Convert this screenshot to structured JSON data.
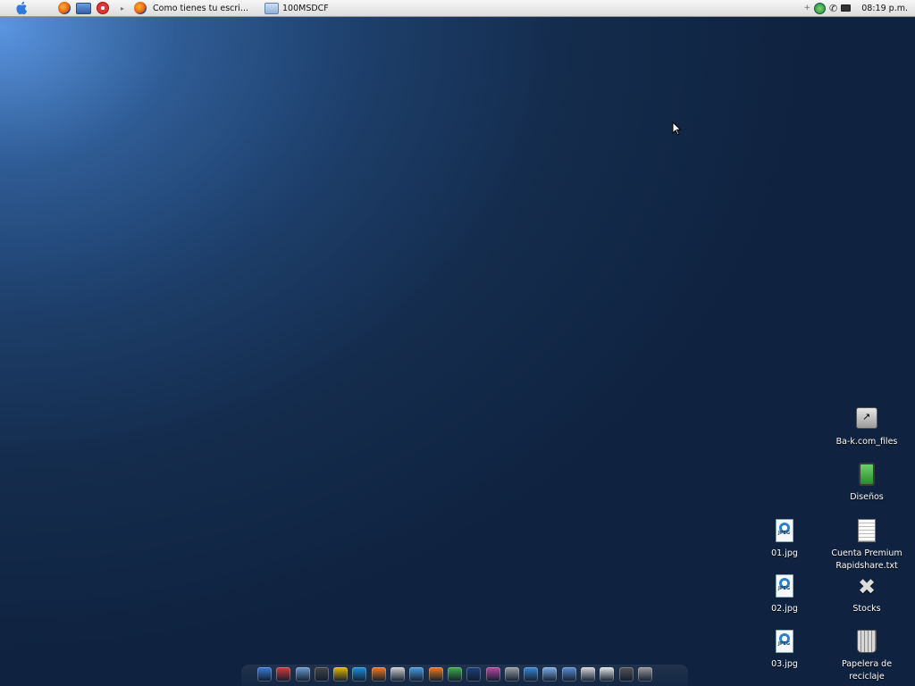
{
  "menubar": {
    "apple_icon": "apple-icon",
    "quicklaunch": [
      "firefox-icon",
      "window-icon",
      "stop-icon"
    ],
    "tasks": [
      {
        "icon": "firefox-icon",
        "label": "Como tienes tu escri..."
      },
      {
        "icon": "folder-icon",
        "label": "100MSDCF"
      }
    ],
    "tray": [
      "plus-icon",
      "globe-icon",
      "phone-icon",
      "battery-icon"
    ],
    "clock": "08:19 p.m."
  },
  "desktop": {
    "icons": [
      {
        "name": "Ba-k.com_files",
        "type": "drive-shortcut-icon"
      },
      {
        "name": "Diseños",
        "type": "pda-icon"
      },
      {
        "name": "01.jpg",
        "type": "jpeg-file-icon"
      },
      {
        "name": "Cuenta Premium Rapidshare.txt",
        "type": "text-file-icon"
      },
      {
        "name": "02.jpg",
        "type": "jpeg-file-icon"
      },
      {
        "name": "Stocks",
        "type": "tools-icon"
      },
      {
        "name": "03.jpg",
        "type": "jpeg-file-icon"
      },
      {
        "name": "Papelera de reciclaje",
        "type": "trash-icon"
      }
    ]
  },
  "dock": {
    "items": [
      {
        "icon": "finder-icon",
        "color": "#3b7bd6"
      },
      {
        "icon": "mail-icon",
        "color": "#d23b3b"
      },
      {
        "icon": "photos-icon",
        "color": "#6f9bd0"
      },
      {
        "icon": "camera-icon",
        "color": "#444444"
      },
      {
        "icon": "keys-icon",
        "color": "#e6b800"
      },
      {
        "icon": "messenger-icon",
        "color": "#1d8fd8"
      },
      {
        "icon": "burn-icon",
        "color": "#f07b1a"
      },
      {
        "icon": "drive-icon",
        "color": "#cfcfcf"
      },
      {
        "icon": "contacts-icon",
        "color": "#4a9ee0"
      },
      {
        "icon": "firefox-icon",
        "color": "#ef7c1a"
      },
      {
        "icon": "chrome-icon",
        "color": "#3fae49"
      },
      {
        "icon": "photoshop-icon",
        "color": "#1d3f7a"
      },
      {
        "icon": "equalizer-icon",
        "color": "#b94aa0"
      },
      {
        "icon": "printer-icon",
        "color": "#9aa0a8"
      },
      {
        "icon": "monitor-icon",
        "color": "#3a86d6"
      },
      {
        "icon": "window-icon",
        "color": "#7fb0e8"
      },
      {
        "icon": "mac-icon",
        "color": "#5b8fd1"
      },
      {
        "icon": "terminal-icon",
        "color": "#d9d9d9"
      },
      {
        "icon": "notes-icon",
        "color": "#e8e8e8"
      },
      {
        "icon": "flag-icon",
        "color": "#555555"
      },
      {
        "icon": "trash-icon",
        "color": "#9a9a9a"
      }
    ]
  }
}
